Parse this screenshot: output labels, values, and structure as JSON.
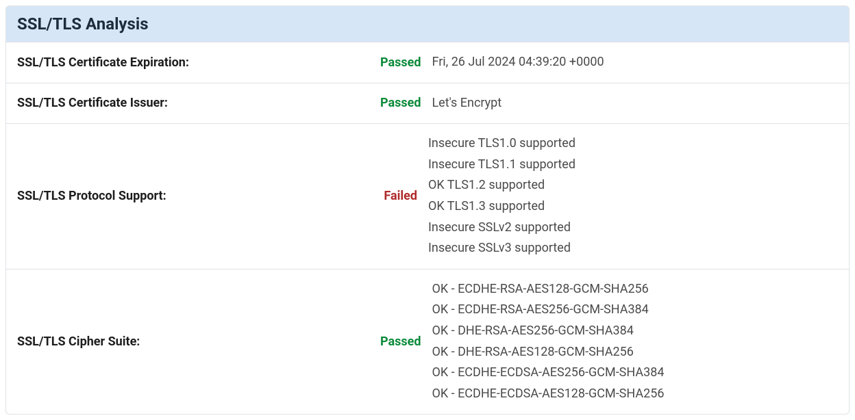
{
  "title": "SSL/TLS Analysis",
  "status_labels": {
    "passed": "Passed",
    "failed": "Failed"
  },
  "rows": [
    {
      "label": "SSL/TLS Certificate Expiration:",
      "status": "passed",
      "values": [
        "Fri, 26 Jul 2024 04:39:20 +0000"
      ]
    },
    {
      "label": "SSL/TLS Certificate Issuer:",
      "status": "passed",
      "values": [
        "Let's Encrypt"
      ]
    },
    {
      "label": "SSL/TLS Protocol Support:",
      "status": "failed",
      "values": [
        "Insecure TLS1.0 supported",
        "Insecure TLS1.1 supported",
        "OK TLS1.2 supported",
        "OK TLS1.3 supported",
        "Insecure SSLv2 supported",
        "Insecure SSLv3 supported"
      ]
    },
    {
      "label": "SSL/TLS Cipher Suite:",
      "status": "passed",
      "values": [
        "OK - ECDHE-RSA-AES128-GCM-SHA256",
        "OK - ECDHE-RSA-AES256-GCM-SHA384",
        "OK - DHE-RSA-AES256-GCM-SHA384",
        "OK - DHE-RSA-AES128-GCM-SHA256",
        "OK - ECDHE-ECDSA-AES256-GCM-SHA384",
        "OK - ECDHE-ECDSA-AES128-GCM-SHA256"
      ]
    }
  ]
}
